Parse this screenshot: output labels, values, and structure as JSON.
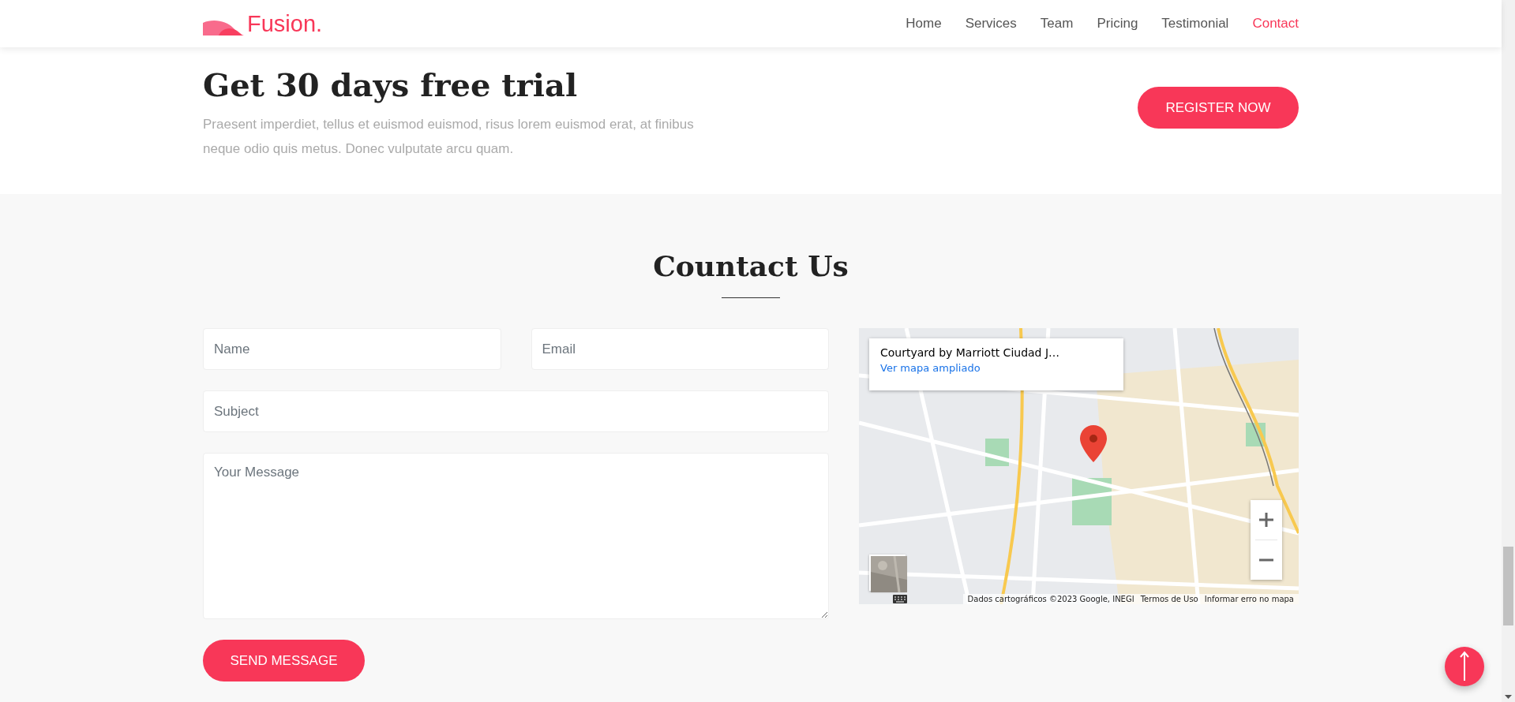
{
  "header": {
    "logo": "Fusion.",
    "nav": [
      {
        "label": "Home",
        "selected": false
      },
      {
        "label": "Services",
        "selected": false
      },
      {
        "label": "Team",
        "selected": false
      },
      {
        "label": "Pricing",
        "selected": false
      },
      {
        "label": "Testimonial",
        "selected": false
      },
      {
        "label": "Contact",
        "selected": true
      }
    ]
  },
  "promo": {
    "title": "Get 30 days free trial",
    "text": "Praesent imperdiet, tellus et euismod euismod, risus lorem euismod erat, at finibus neque odio quis metus. Donec vulputate arcu quam.",
    "button": "REGISTER NOW"
  },
  "contact": {
    "title": "Countact Us",
    "fields": [
      {
        "kind": "input",
        "placeholder": "Name"
      },
      {
        "kind": "input",
        "placeholder": "Email"
      },
      {
        "kind": "input",
        "placeholder": "Subject"
      },
      {
        "kind": "textarea",
        "placeholder": "Your Message"
      }
    ],
    "button": "SEND MESSAGE"
  },
  "map": {
    "place_title": "Courtyard by Marriott Ciudad J…",
    "link": "Ver mapa ampliado",
    "attribution": "Dados cartográficos ©2023 Google, INEGI",
    "links": [
      "Termos de Uso",
      "Informar erro no mapa"
    ]
  }
}
